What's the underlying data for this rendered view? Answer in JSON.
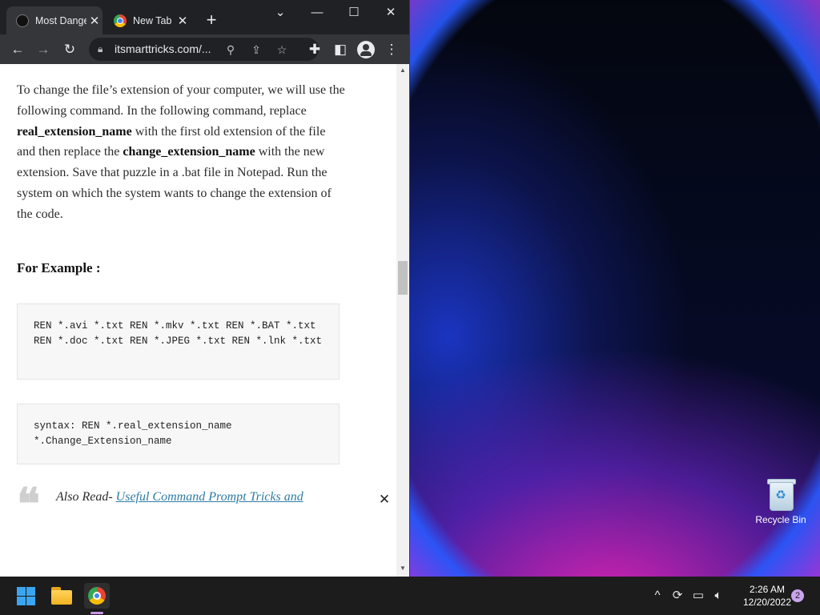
{
  "browser": {
    "tabs": [
      {
        "label": "Most Dangerous CMD"
      },
      {
        "label": "New Tab"
      }
    ],
    "url": "itsmarttricks.com/..."
  },
  "article": {
    "p1": "To change the file’s extension of your computer, we will use the following command. In the following command, replace ",
    "bold1": "real_extension_name",
    "p2": " with the first old extension of the file and then replace the ",
    "bold2": "change_extension_name",
    "p3": " with the new extension. Save that puzzle in a .bat file in Notepad. Run the system on which the system wants to change the extension of the code.",
    "heading": "For Example :",
    "code1": "REN *.avi *.txt REN *.mkv *.txt REN *.BAT *.txt REN *.doc *.txt REN *.JPEG *.txt REN *.lnk *.txt",
    "code2": "syntax: REN *.real_extension_name *.Change_Extension_name",
    "quote_prefix": "Also Read- ",
    "quote_link": "Useful Command Prompt Tricks and"
  },
  "desktop": {
    "recycle_bin_label": "Recycle Bin"
  },
  "taskbar": {
    "time": "2:26 AM",
    "date": "12/20/2022",
    "notification_count": "2"
  },
  "icons": {
    "tab_favicon_active": "site-favicon-icon",
    "tab_favicon_inactive": "chrome-icon",
    "accent": "#3aa6f0"
  }
}
